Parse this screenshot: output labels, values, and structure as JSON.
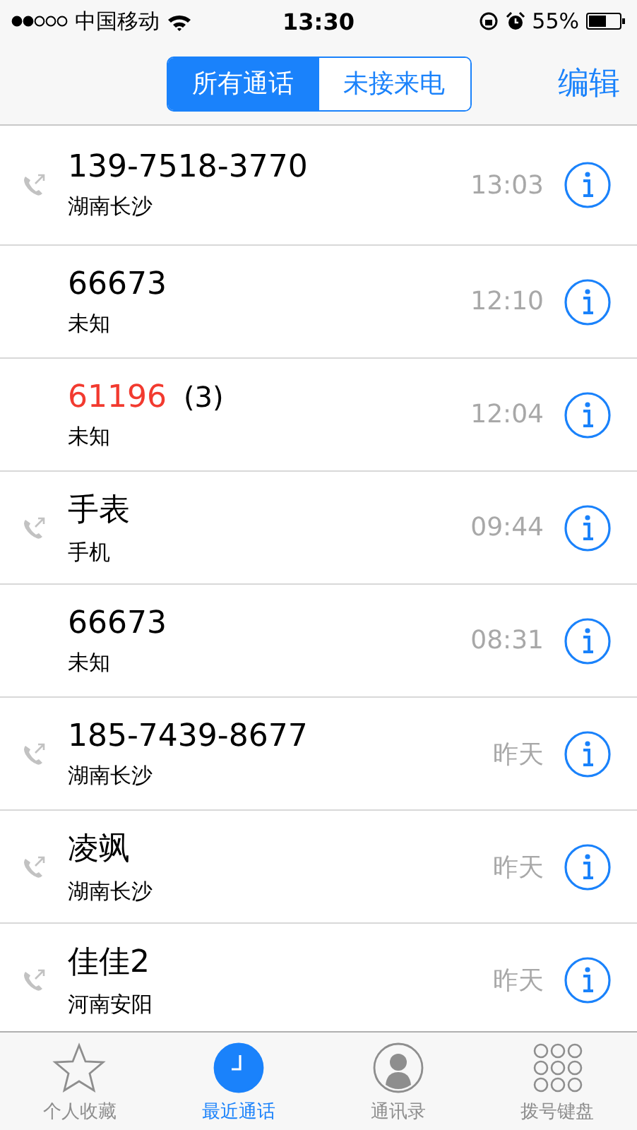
{
  "status_bar": {
    "carrier": "中国移动",
    "time": "13:30",
    "battery": "55%"
  },
  "nav": {
    "segments": [
      {
        "label": "所有通话",
        "selected": true
      },
      {
        "label": "未接来电",
        "selected": false
      }
    ],
    "edit": "编辑"
  },
  "calls": [
    {
      "name": "139-7518-3770",
      "detail": "湖南长沙",
      "time": "13:03",
      "outgoing": true,
      "missed": false
    },
    {
      "name": "66673",
      "detail": "未知",
      "time": "12:10",
      "outgoing": false,
      "missed": false
    },
    {
      "name": "61196",
      "count": "(3)",
      "detail": "未知",
      "time": "12:04",
      "outgoing": false,
      "missed": true
    },
    {
      "name": "手表",
      "detail": "手机",
      "time": "09:44",
      "outgoing": true,
      "missed": false
    },
    {
      "name": "66673",
      "detail": "未知",
      "time": "08:31",
      "outgoing": false,
      "missed": false
    },
    {
      "name": "185-7439-8677",
      "detail": "湖南长沙",
      "time": "昨天",
      "outgoing": true,
      "missed": false
    },
    {
      "name": "凌飒",
      "detail": "湖南长沙",
      "time": "昨天",
      "outgoing": true,
      "missed": false
    },
    {
      "name": "佳佳2",
      "detail": "河南安阳",
      "time": "昨天",
      "outgoing": true,
      "missed": false
    }
  ],
  "tabs": [
    {
      "kind": "favorites",
      "label": "个人收藏",
      "selected": false
    },
    {
      "kind": "recents",
      "label": "最近通话",
      "selected": true
    },
    {
      "kind": "contacts",
      "label": "通讯录",
      "selected": false
    },
    {
      "kind": "keypad",
      "label": "拨号键盘",
      "selected": false
    }
  ]
}
